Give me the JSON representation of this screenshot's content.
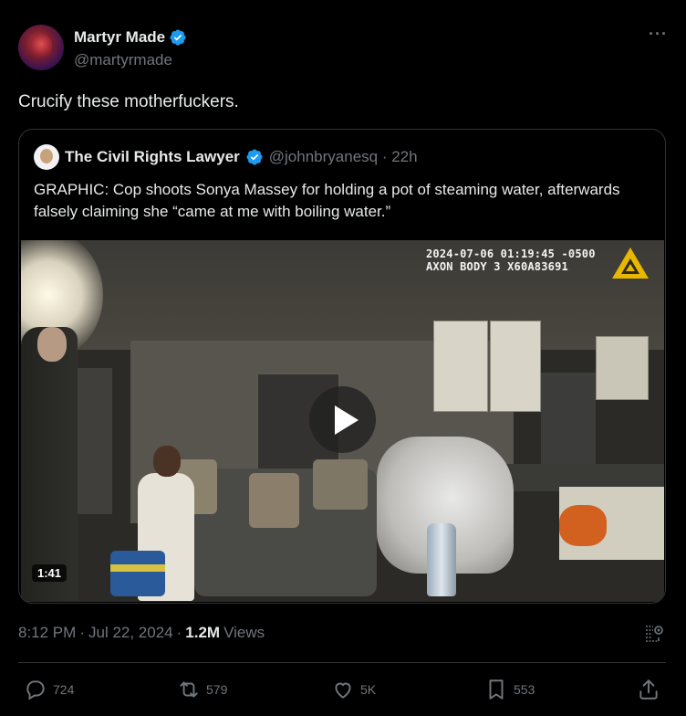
{
  "author": {
    "name": "Martyr Made",
    "handle": "@martyrmade"
  },
  "tweet": {
    "text": "Crucify these motherfuckers."
  },
  "quote": {
    "name": "The Civil Rights Lawyer",
    "handle_time": "@johnbryanesq · 22h",
    "text": "GRAPHIC: Cop shoots Sonya Massey for holding a pot of steaming water, afterwards falsely claiming she “came at me with boiling water.”",
    "video": {
      "timestamp_line1": "2024-07-06 01:19:45 -0500",
      "timestamp_line2": "AXON BODY 3 X60A83691",
      "duration": "1:41"
    }
  },
  "meta": {
    "time": "8:12 PM",
    "date": "Jul 22, 2024",
    "views_count": "1.2M",
    "views_label": "Views"
  },
  "actions": {
    "replies": "724",
    "reposts": "579",
    "likes": "5K",
    "bookmarks": "553"
  },
  "colors": {
    "background": "#000000",
    "text": "#e7e9ea",
    "secondary": "#71767b",
    "verified": "#1d9bf0",
    "border": "#2f3336"
  }
}
